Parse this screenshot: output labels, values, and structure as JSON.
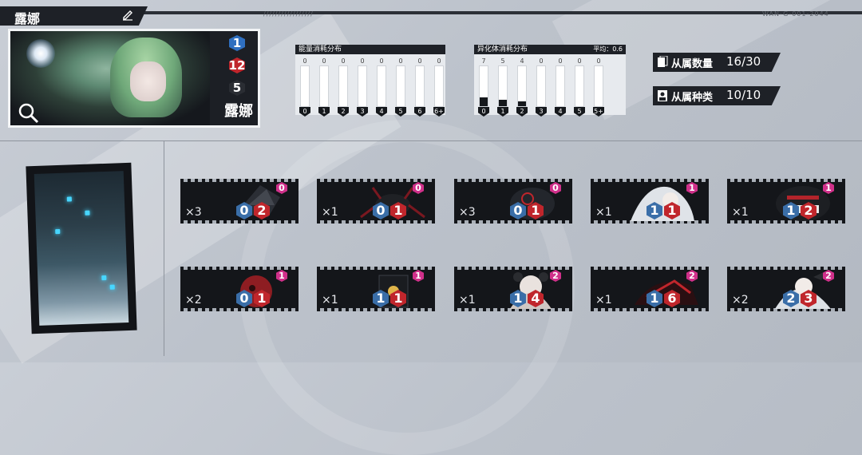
{
  "header": {
    "title": "露娜",
    "code_left": "/////////////////",
    "code_right": "WAN-G-001-2044"
  },
  "portrait": {
    "name": "露娜",
    "stats": [
      {
        "value": "1",
        "color": "#2f6fc0"
      },
      {
        "value": "12",
        "color": "#c0262c"
      },
      {
        "value": "5",
        "color": "#2a2d33"
      }
    ]
  },
  "energy_distribution": {
    "title": "能量消耗分布",
    "bins": [
      "0",
      "1",
      "2",
      "3",
      "4",
      "5",
      "6",
      "6+"
    ],
    "counts": [
      0,
      0,
      0,
      0,
      0,
      0,
      0,
      0
    ]
  },
  "anomaly_distribution": {
    "title": "异化体消耗分布",
    "average_label": "平均：0.6",
    "bins": [
      "0",
      "1",
      "2",
      "3",
      "4",
      "5",
      "5+"
    ],
    "counts": [
      7,
      5,
      4,
      0,
      0,
      0,
      0
    ]
  },
  "summary": {
    "quantity_label": "从属数量",
    "quantity_value": "16/30",
    "types_label": "从属种类",
    "types_value": "10/10"
  },
  "minions": [
    {
      "count": "×3",
      "cost_a": "0",
      "cost_b": "2",
      "tier": "0",
      "art": "dark-shard"
    },
    {
      "count": "×1",
      "cost_a": "0",
      "cost_b": "1",
      "tier": "0",
      "art": "black-spider"
    },
    {
      "count": "×3",
      "cost_a": "0",
      "cost_b": "1",
      "tier": "0",
      "art": "shadow-beast"
    },
    {
      "count": "×1",
      "cost_a": "1",
      "cost_b": "1",
      "tier": "1",
      "art": "white-hair-girl"
    },
    {
      "count": "×1",
      "cost_a": "1",
      "cost_b": "2",
      "tier": "1",
      "art": "fanged-creature"
    },
    {
      "count": "×2",
      "cost_a": "0",
      "cost_b": "1",
      "tier": "1",
      "art": "red-orb"
    },
    {
      "count": "×1",
      "cost_a": "1",
      "cost_b": "1",
      "tier": "1",
      "art": "black-box"
    },
    {
      "count": "×1",
      "cost_a": "1",
      "cost_b": "4",
      "tier": "2",
      "art": "pale-doll-girl"
    },
    {
      "count": "×1",
      "cost_a": "1",
      "cost_b": "6",
      "tier": "2",
      "art": "crimson-hound"
    },
    {
      "count": "×2",
      "cost_a": "2",
      "cost_b": "3",
      "tier": "2",
      "art": "twin-tail-girl"
    }
  ]
}
